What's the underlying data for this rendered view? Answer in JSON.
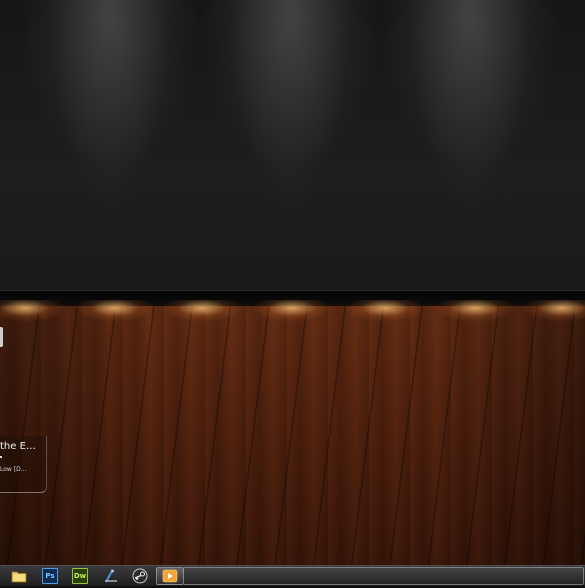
{
  "desktop": {
    "notification": {
      "title": "the E…",
      "subtitle": "Low [D…"
    }
  },
  "taskbar": {
    "items": [
      {
        "icon": "folder-icon",
        "label": ""
      },
      {
        "icon": "photoshop-icon",
        "label": "Ps"
      },
      {
        "icon": "dreamweaver-icon",
        "label": "Dw"
      },
      {
        "icon": "tool-icon",
        "label": ""
      },
      {
        "icon": "steam-icon",
        "label": ""
      },
      {
        "icon": "media-player-icon",
        "label": ""
      }
    ]
  }
}
